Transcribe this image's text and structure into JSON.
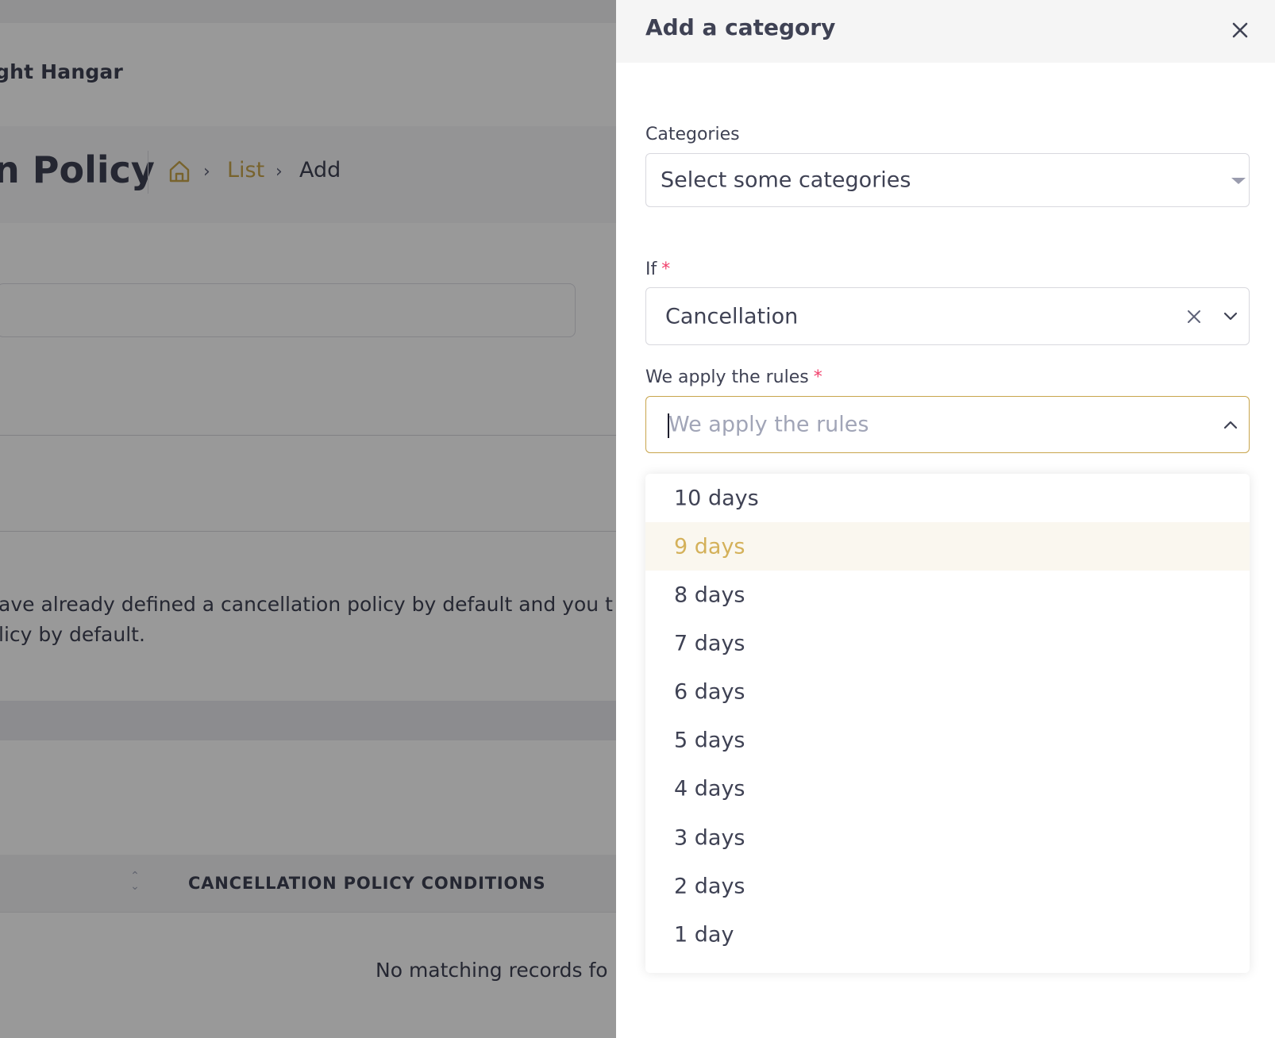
{
  "background_page": {
    "brand_name": "ght Hangar",
    "page_title": "n Policy",
    "breadcrumb": {
      "list_label": "List",
      "current_label": "Add"
    },
    "notice_line_1": "ave already defined a cancellation policy by default and you t",
    "notice_line_2": "licy by default.",
    "table": {
      "header_conditions": "CANCELLATION POLICY CONDITIONS",
      "empty_text": "No matching records fo"
    }
  },
  "drawer": {
    "title": "Add a category",
    "close_icon": "close-icon",
    "categories": {
      "label": "Categories",
      "placeholder": "Select some categories"
    },
    "if_field": {
      "label": "If",
      "required_mark": "*",
      "value": "Cancellation"
    },
    "rules_field": {
      "label": "We apply the rules",
      "required_mark": "*",
      "placeholder": "We apply the rules",
      "expanded": true
    },
    "rules_options": [
      {
        "label": "10 days"
      },
      {
        "label": "9 days",
        "highlighted": true
      },
      {
        "label": "8 days"
      },
      {
        "label": "7 days"
      },
      {
        "label": "6 days"
      },
      {
        "label": "5 days"
      },
      {
        "label": "4 days"
      },
      {
        "label": "3 days"
      },
      {
        "label": "2 days"
      },
      {
        "label": "1 day"
      }
    ]
  },
  "colors": {
    "accent_gold": "#c8a54c",
    "highlight_text": "#d4b15a",
    "highlight_bg": "#faf7ef",
    "required_red": "#f1416c",
    "text_dark": "#3f4254",
    "placeholder": "#a1a5b7"
  }
}
